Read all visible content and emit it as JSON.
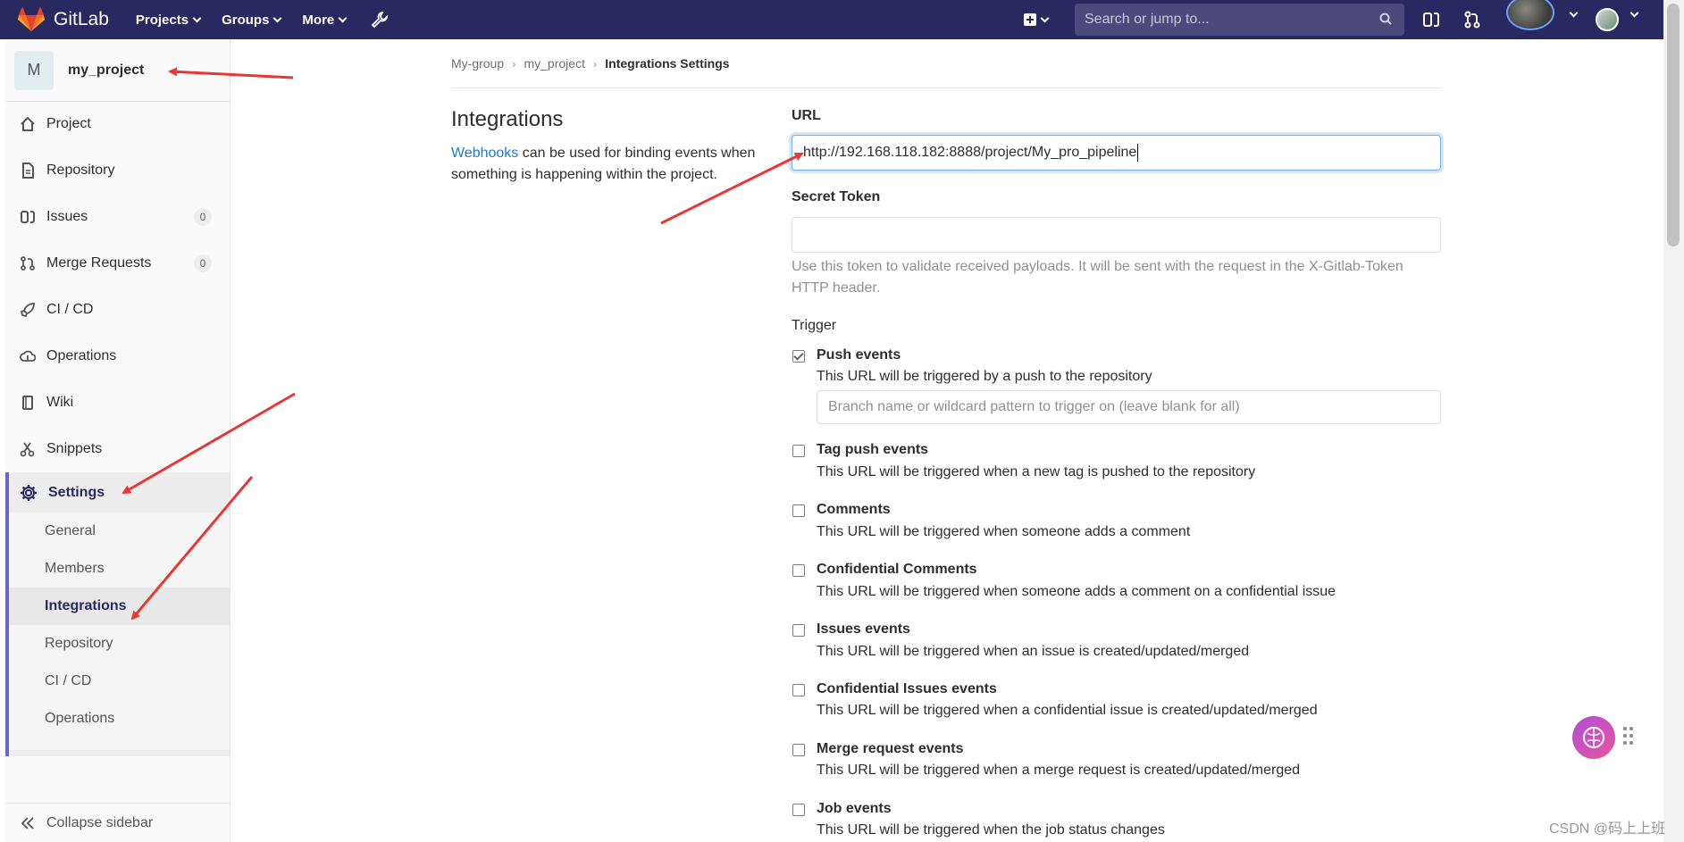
{
  "navbar": {
    "brand": "GitLab",
    "menu": [
      {
        "label": "Projects"
      },
      {
        "label": "Groups"
      },
      {
        "label": "More"
      }
    ],
    "search_placeholder": "Search or jump to...",
    "icons": [
      "gitlab-logo",
      "wrench-icon",
      "plus-square-icon",
      "search-icon",
      "issues-icon",
      "merge-request-icon",
      "user-avatar"
    ]
  },
  "sidebar": {
    "project_initial": "M",
    "project_name": "my_project",
    "items": [
      {
        "label": "Project",
        "icon": "home-icon"
      },
      {
        "label": "Repository",
        "icon": "doc-icon"
      },
      {
        "label": "Issues",
        "icon": "issues-icon",
        "badge": "0"
      },
      {
        "label": "Merge Requests",
        "icon": "merge-request-icon",
        "badge": "0"
      },
      {
        "label": "CI / CD",
        "icon": "rocket-icon"
      },
      {
        "label": "Operations",
        "icon": "cloud-icon"
      },
      {
        "label": "Wiki",
        "icon": "book-icon"
      },
      {
        "label": "Snippets",
        "icon": "scissors-icon"
      }
    ],
    "settings": {
      "label": "Settings",
      "subitems": [
        {
          "label": "General"
        },
        {
          "label": "Members"
        },
        {
          "label": "Integrations",
          "active": true
        },
        {
          "label": "Repository"
        },
        {
          "label": "CI / CD"
        },
        {
          "label": "Operations"
        }
      ]
    },
    "collapse_label": "Collapse sidebar"
  },
  "breadcrumb": [
    "My-group",
    "my_project",
    "Integrations Settings"
  ],
  "main": {
    "title": "Integrations",
    "desc_link": "Webhooks",
    "desc_text": " can be used for binding events when something is happening within the project.",
    "url_label": "URL",
    "url_value": "http://192.168.118.182:8888/project/My_pro_pipeline",
    "secret_label": "Secret Token",
    "secret_value": "",
    "secret_help": "Use this token to validate received payloads. It will be sent with the request in the X-Gitlab-Token HTTP header.",
    "trigger_label": "Trigger",
    "branch_placeholder": "Branch name or wildcard pattern to trigger on (leave blank for all)",
    "events": [
      {
        "title": "Push events",
        "desc": "This URL will be triggered by a push to the repository",
        "checked": true
      },
      {
        "title": "Tag push events",
        "desc": "This URL will be triggered when a new tag is pushed to the repository",
        "checked": false
      },
      {
        "title": "Comments",
        "desc": "This URL will be triggered when someone adds a comment",
        "checked": false
      },
      {
        "title": "Confidential Comments",
        "desc": "This URL will be triggered when someone adds a comment on a confidential issue",
        "checked": false
      },
      {
        "title": "Issues events",
        "desc": "This URL will be triggered when an issue is created/updated/merged",
        "checked": false
      },
      {
        "title": "Confidential Issues events",
        "desc": "This URL will be triggered when a confidential issue is created/updated/merged",
        "checked": false
      },
      {
        "title": "Merge request events",
        "desc": "This URL will be triggered when a merge request is created/updated/merged",
        "checked": false
      },
      {
        "title": "Job events",
        "desc": "This URL will be triggered when the job status changes",
        "checked": false
      }
    ]
  },
  "watermark": "CSDN @码上上班",
  "colors": {
    "navbar": "#292961",
    "accent": "#6666c4",
    "link": "#1f78d1",
    "annotation": "#e53935"
  }
}
